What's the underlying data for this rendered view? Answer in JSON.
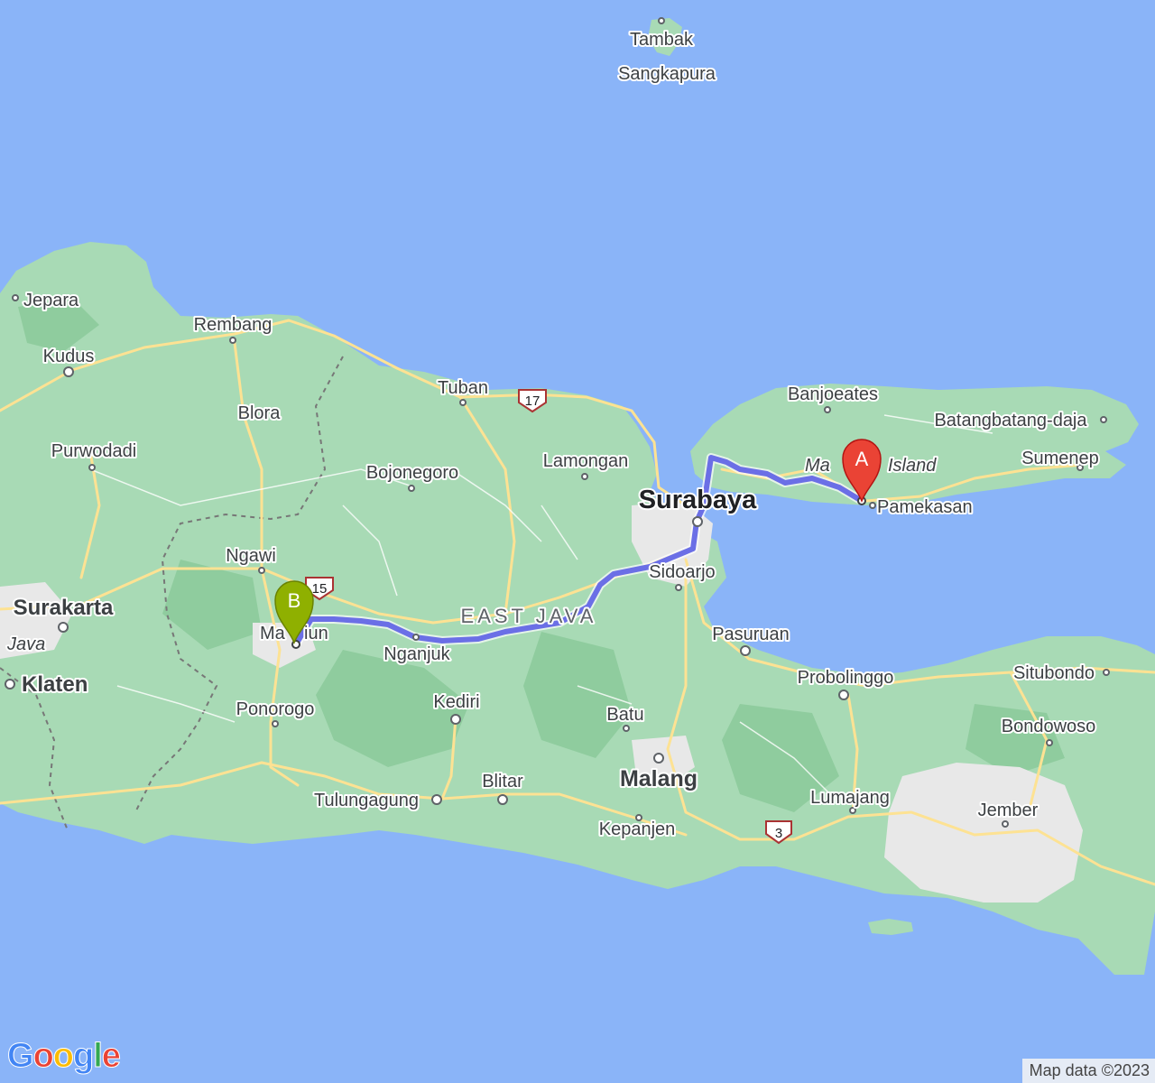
{
  "colors": {
    "sea": "#8ab4f8",
    "land": "#a8dab5",
    "land_dark": "#8fcc9e",
    "urban": "#e8e8e8",
    "road": "#fde293",
    "route": "#6b6fe6",
    "marker_a": "#ea4335",
    "marker_b": "#8fb000"
  },
  "markers": {
    "a": {
      "label": "A"
    },
    "b": {
      "label": "B"
    }
  },
  "places": {
    "tambak": "Tambak",
    "sangkapura": "Sangkapura",
    "jepara": "Jepara",
    "rembang": "Rembang",
    "kudus": "Kudus",
    "tuban": "Tuban",
    "blora": "Blora",
    "purwodadi": "Purwodadi",
    "bojonegoro": "Bojonegoro",
    "lamongan": "Lamongan",
    "banjoeates": "Banjoeates",
    "batangbatang": "Batangbatang-daja",
    "sumenep": "Sumenep",
    "madura_prefix": "Ma",
    "madura_suffix": "Island",
    "pamekasan": "Pamekasan",
    "surabaya": "Surabaya",
    "ngawi": "Ngawi",
    "sidoarjo": "Sidoarjo",
    "surakarta": "Surakarta",
    "java": "Java",
    "east_java": "EAST JAVA",
    "madiun_left": "Ma",
    "madiun_right": "iun",
    "nganjuk": "Nganjuk",
    "pasuruan": "Pasuruan",
    "situbondo": "Situbondo",
    "klaten": "Klaten",
    "probolinggo": "Probolinggo",
    "ponorogo": "Ponorogo",
    "kediri": "Kediri",
    "batu": "Batu",
    "bondowoso": "Bondowoso",
    "malang": "Malang",
    "blitar": "Blitar",
    "tulungagung": "Tulungagung",
    "lumajang": "Lumajang",
    "jember": "Jember",
    "kepanjen": "Kepanjen"
  },
  "road_shields": {
    "r17": "17",
    "r15": "15",
    "r3": "3"
  },
  "branding": {
    "logo": [
      "G",
      "o",
      "o",
      "g",
      "l",
      "e"
    ],
    "attribution": "Map data ©2023"
  }
}
